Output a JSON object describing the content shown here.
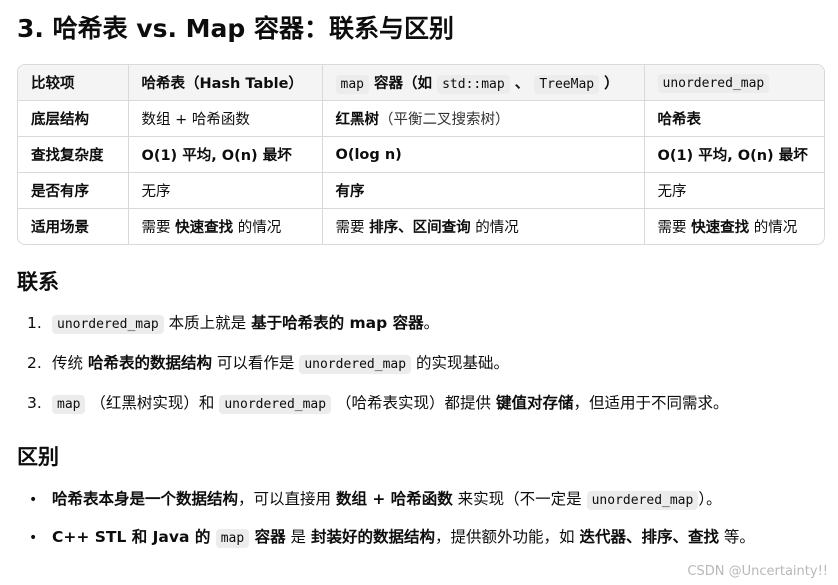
{
  "title": "3. 哈希表 vs. Map 容器：联系与区别",
  "table": {
    "headers": {
      "c1": "比较项",
      "c2": "哈希表（Hash Table）",
      "c3_code": "map",
      "c3_text": " 容器（如 ",
      "c3_code2": "std::map",
      "c3_sep": " 、 ",
      "c3_code3": "TreeMap",
      "c3_end": " ）",
      "c4_code": "unordered_map"
    },
    "rows": [
      {
        "label": "底层结构",
        "c2": "数组 + 哈希函数",
        "c3_bold": "红黑树",
        "c3_rest": "（平衡二叉搜索树）",
        "c4_bold": "哈希表"
      },
      {
        "label": "查找复杂度",
        "c2_bold": "O(1) 平均, O(n) 最坏",
        "c3_bold": "O(log n)",
        "c4_bold": "O(1) 平均, O(n) 最坏"
      },
      {
        "label": "是否有序",
        "c2": "无序",
        "c3_bold": "有序",
        "c4": "无序"
      },
      {
        "label": "适用场景",
        "c2_pre": "需要 ",
        "c2_bold": "快速查找",
        "c2_post": " 的情况",
        "c3_pre": "需要 ",
        "c3_bold": "排序、区间查询",
        "c3_post": " 的情况",
        "c4_pre": "需要 ",
        "c4_bold": "快速查找",
        "c4_post": " 的情况"
      }
    ]
  },
  "links": {
    "heading": "联系",
    "items": [
      {
        "num": "1.",
        "code": "unordered_map",
        "text": " 本质上就是 ",
        "bold": "基于哈希表的 map 容器",
        "end": "。"
      },
      {
        "num": "2.",
        "pre": "传统 ",
        "bold": "哈希表的数据结构",
        "mid": " 可以看作是 ",
        "code": "unordered_map",
        "end": " 的实现基础。"
      },
      {
        "num": "3.",
        "code": "map",
        "mid1": " （红黑树实现）和 ",
        "code2": "unordered_map",
        "mid2": " （哈希表实现）都提供 ",
        "bold": "键值对存储",
        "end": "，但适用于不同需求。"
      }
    ]
  },
  "diff": {
    "heading": "区别",
    "items": [
      {
        "bullet": "•",
        "bold1": "哈希表本身是一个数据结构",
        "mid1": "，可以直接用 ",
        "bold2": "数组 + 哈希函数",
        "mid2": " 来实现（不一定是 ",
        "code": "unordered_map",
        "end": "）。"
      },
      {
        "bullet": "•",
        "bold1": "C++ STL 和 Java 的 ",
        "code": "map",
        "bold2": " 容器",
        "mid1": " 是 ",
        "bold3": "封装好的数据结构",
        "mid2": "，提供额外功能，如 ",
        "bold4": "迭代器、排序、查找",
        "end": " 等。"
      }
    ]
  },
  "watermark": "CSDN @Uncertainty!!"
}
